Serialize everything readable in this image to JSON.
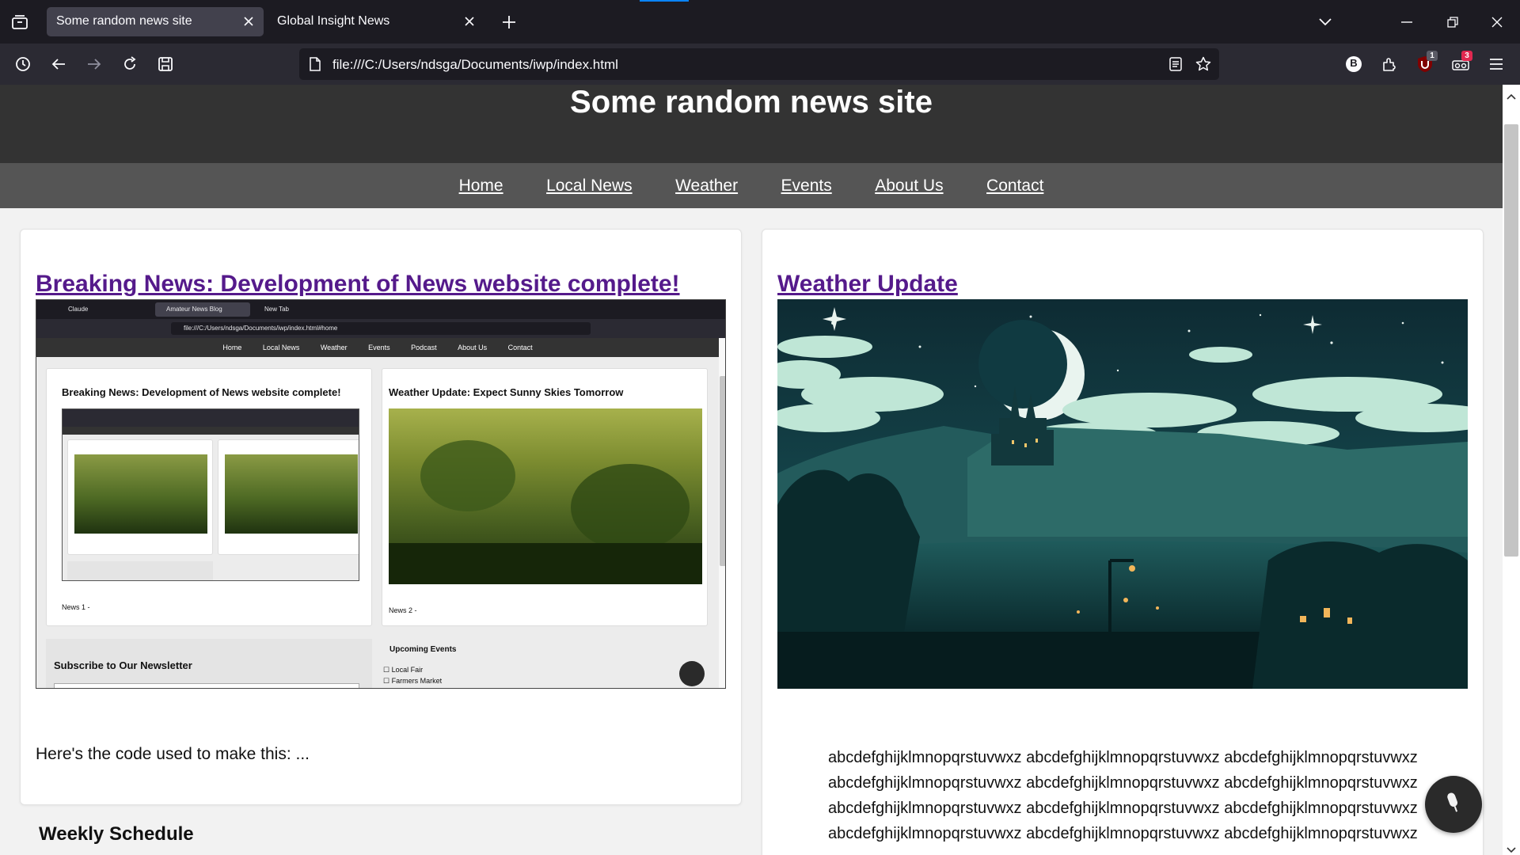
{
  "browser": {
    "tabs": [
      {
        "title": "Some random news site",
        "active": true
      },
      {
        "title": "Global Insight News",
        "active": false
      }
    ],
    "url": "file:///C:/Users/ndsga/Documents/iwp/index.html",
    "extension_badges": {
      "ublock": "1",
      "other": "3"
    },
    "profile_letter": "B"
  },
  "site": {
    "title": "Some random news site",
    "nav": [
      "Home",
      "Local News",
      "Weather",
      "Events",
      "About Us",
      "Contact"
    ]
  },
  "articles": {
    "left": {
      "heading": "Breaking News: Development of News website complete!",
      "text": "Here's the code used to make this: ..."
    },
    "right": {
      "heading": "Weather Update",
      "text_lines": [
        "abcdefghijklmnopqrstuvwxz abcdefghijklmnopqrstuvwxz abcdefghijklmnopqrstuvwxz",
        "abcdefghijklmnopqrstuvwxz abcdefghijklmnopqrstuvwxz abcdefghijklmnopqrstuvwxz",
        "abcdefghijklmnopqrstuvwxz abcdefghijklmnopqrstuvwxz abcdefghijklmnopqrstuvwxz",
        "abcdefghijklmnopqrstuvwxz abcdefghijklmnopqrstuvwxz abcdefghijklmnopqrstuvwxz"
      ]
    }
  },
  "weekly_schedule": "Weekly Schedule",
  "embedded_screenshot": {
    "tabs": [
      "Claude",
      "Amateur News Blog",
      "New Tab"
    ],
    "url": "file:///C:/Users/ndsga/Documents/iwp/index.html#home",
    "nav": [
      "Home",
      "Local News",
      "Weather",
      "Events",
      "Podcast",
      "About Us",
      "Contact"
    ],
    "card1_heading": "Breaking News: Development of News website complete!",
    "card2_heading": "Weather Update: Expect Sunny Skies Tomorrow",
    "news1": "News 1 -",
    "news2": "News 2 -",
    "newsletter": "Subscribe to Our Newsletter",
    "events_heading": "Upcoming Events",
    "events": [
      "Local Fair",
      "Farmers Market"
    ]
  },
  "colors": {
    "header_bg": "#333333",
    "nav_bg": "#555555",
    "link_visited": "#551a8b",
    "page_bg": "#f2f2f2"
  },
  "icons": [
    "library-icon",
    "close-icon",
    "new-tab-icon",
    "list-all-tabs-icon",
    "minimize-icon",
    "restore-icon",
    "window-close-icon",
    "history-icon",
    "back-icon",
    "forward-icon",
    "reload-icon",
    "save-page-icon",
    "page-icon",
    "reader-view-icon",
    "bookmark-star-icon",
    "profile-icon",
    "extensions-icon",
    "ublock-icon",
    "extension-badge-icon",
    "hamburger-menu-icon",
    "microphone-icon"
  ]
}
